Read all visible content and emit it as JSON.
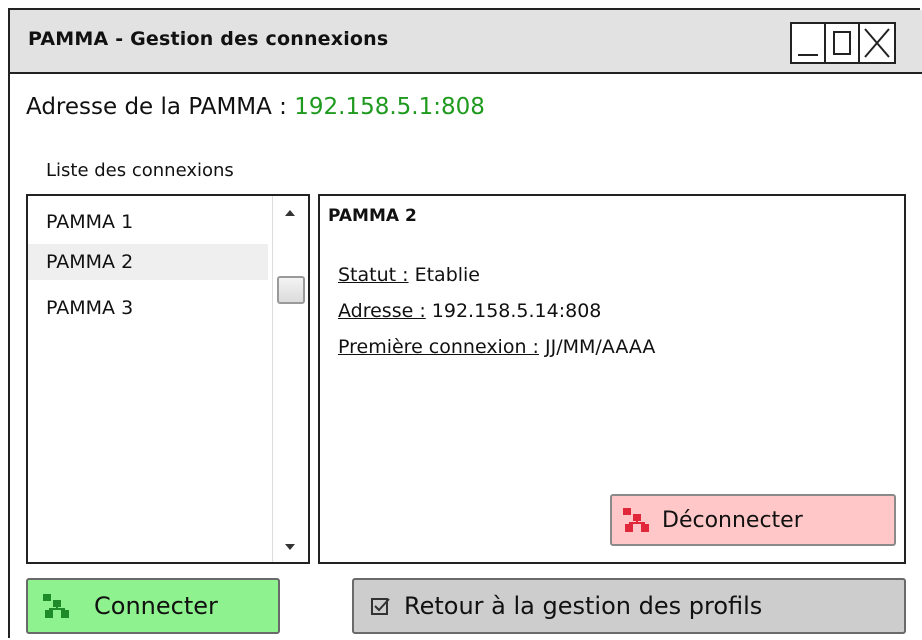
{
  "window": {
    "title": "PAMMA - Gestion des connexions"
  },
  "address": {
    "label": "Adresse de la PAMMA :",
    "value": "192.158.5.1:808",
    "value_color": "#1f9a1f"
  },
  "connections": {
    "title": "Liste des connexions",
    "items": [
      {
        "label": "PAMMA 1",
        "selected": false
      },
      {
        "label": "PAMMA 2",
        "selected": true
      },
      {
        "label": "PAMMA 3",
        "selected": false
      }
    ]
  },
  "details": {
    "title": "PAMMA 2",
    "status_label": "Statut :",
    "status_value": "Etablie",
    "address_label": "Adresse :",
    "address_value": "192.158.5.14:808",
    "first_connection_label": "Première connexion :",
    "first_connection_value": "JJ/MM/AAAA"
  },
  "buttons": {
    "disconnect": "Déconnecter",
    "connect": "Connecter",
    "back": "Retour à la gestion des profils"
  },
  "icons": {
    "disconnect": "network-icon",
    "connect": "network-icon",
    "back": "checkbox-icon"
  },
  "colors": {
    "connect_bg": "#8ef28e",
    "disconnect_bg": "#ffc7c7",
    "back_bg": "#cdcdcd",
    "titlebar_bg": "#e2e2e2"
  }
}
